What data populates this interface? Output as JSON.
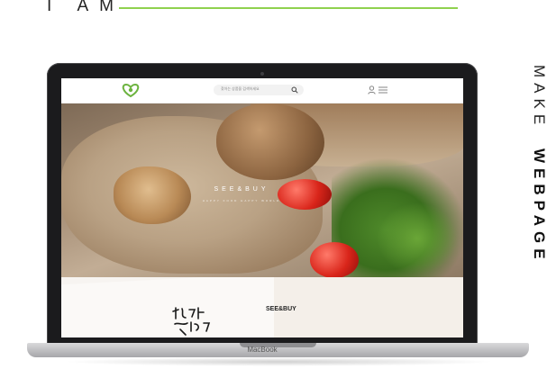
{
  "header": {
    "headline": "I AM"
  },
  "side": {
    "make": "MAKE",
    "webpage": "WEBPAGE"
  },
  "laptop": {
    "brand": "MacBook"
  },
  "site": {
    "search_placeholder": "찾아는 상품을 검색하세요",
    "hero_title": "SEE&BUY",
    "hero_subtitle": "HAPPY FOOD HAPPY WORLD",
    "section_title": "SEE&BUY"
  },
  "colors": {
    "accent": "#8fd14f",
    "logo_green": "#6cb33f"
  },
  "icons": [
    "logo-heart-icon",
    "search-icon",
    "user-icon",
    "menu-icon"
  ]
}
